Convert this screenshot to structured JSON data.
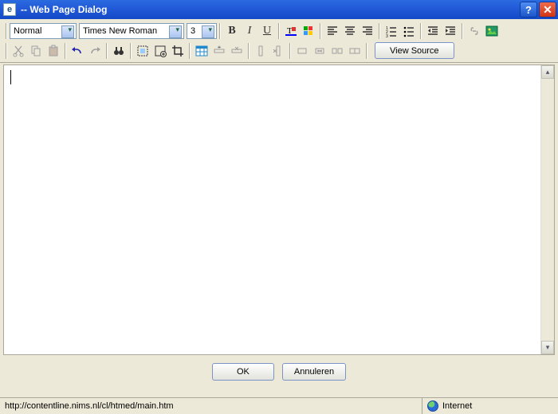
{
  "window": {
    "title": " -- Web Page Dialog"
  },
  "toolbar": {
    "style_select": "Normal",
    "font_select": "Times New Roman",
    "size_select": "3",
    "view_source": "View Source"
  },
  "icons": {
    "bold": "B",
    "italic": "I",
    "underline": "U"
  },
  "editor": {
    "content": ""
  },
  "dialog": {
    "ok": "OK",
    "cancel": "Annuleren"
  },
  "status": {
    "url": "http://contentline.nims.nl/cl/htmed/main.htm",
    "zone": "Internet"
  }
}
